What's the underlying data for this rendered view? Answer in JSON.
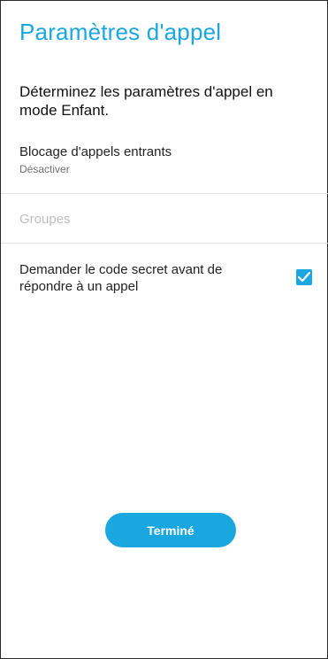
{
  "header": {
    "title": "Paramètres d'appel"
  },
  "intro": {
    "text": "Déterminez les paramètres d'appel en mode Enfant."
  },
  "incoming_block": {
    "label": "Blocage d'appels entrants",
    "value": "Désactiver"
  },
  "groups": {
    "label": "Groupes"
  },
  "pin_setting": {
    "label": "Demander le code secret avant de répondre à un appel",
    "checked": true
  },
  "footer": {
    "done_label": "Terminé"
  },
  "colors": {
    "accent": "#1aa7e0",
    "text": "#222222",
    "disabled": "#bdbdbd",
    "divider": "#e3e3e3"
  }
}
